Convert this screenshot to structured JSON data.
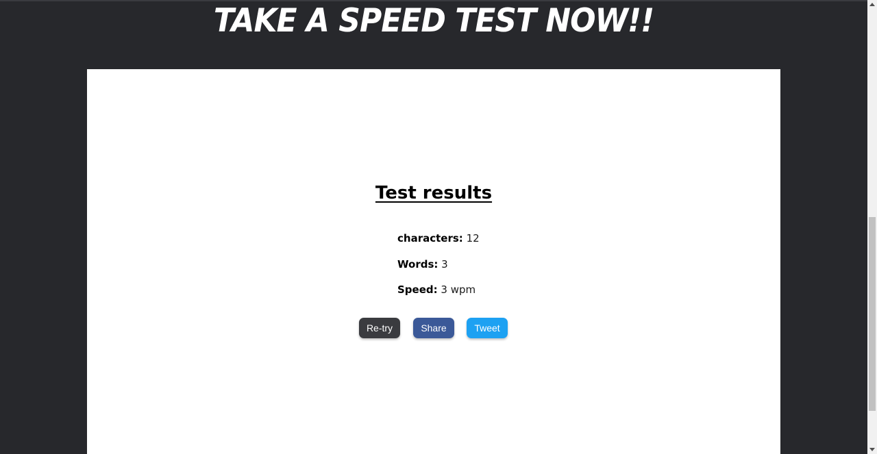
{
  "header": {
    "title": "TAKE A SPEED TEST NOW!!"
  },
  "results": {
    "title": "Test results",
    "stats": [
      {
        "label": "characters:",
        "value": "12"
      },
      {
        "label": "Words:",
        "value": "3"
      },
      {
        "label": "Speed:",
        "value": "3 wpm"
      }
    ]
  },
  "actions": {
    "retry_label": "Re-try",
    "share_label": "Share",
    "tweet_label": "Tweet"
  },
  "colors": {
    "background": "#27282c",
    "card": "#ffffff",
    "retry": "#3a3b3f",
    "share": "#3b5998",
    "tweet": "#1da1f2"
  }
}
